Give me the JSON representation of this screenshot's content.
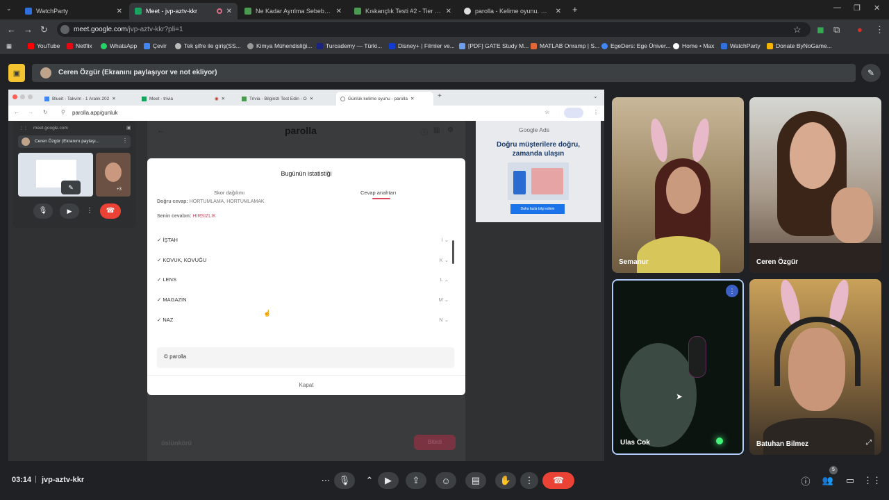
{
  "browser": {
    "tabs": [
      {
        "title": "WatchParty",
        "color": "#2f6fe0"
      },
      {
        "title": "Meet - jvp-aztv-kkr",
        "color": "#1ba261"
      },
      {
        "title": "Ne Kadar Ayrılma Sebebi?? #1",
        "color": "#4a9a52"
      },
      {
        "title": "Kıskançlık Testi #2 - Tier List, Kı",
        "color": "#4a9a52"
      },
      {
        "title": "parolla - Kelime oyunu. Günlük",
        "color": "#dddddd"
      }
    ],
    "url_host": "meet.google.com",
    "url_path": "/jvp-aztv-kkr?pli=1",
    "bookmarks": [
      "YouTube",
      "Netflix",
      "WhatsApp",
      "Çevir",
      "Tek şifre ile giriş(SS...",
      "Kimya Mühendisliği...",
      "Turcademy — Türki...",
      "Disney+ | Filmler ve...",
      "[PDF] GATE Study M...",
      "MATLAB Onramp | S...",
      "EgeDers: Ege Üniver...",
      "Home • Max",
      "WatchParty",
      "Donate ByNoGame..."
    ]
  },
  "meet": {
    "presenter_text": "Ceren Özgür (Ekranını paylaşıyor ve not ekliyor)",
    "time": "03:14",
    "meeting_code": "jvp-aztv-kkr",
    "people_count": "5",
    "participants": [
      {
        "name": "Semanur"
      },
      {
        "name": "Ceren Özgür"
      },
      {
        "name": "Ulas Cok"
      },
      {
        "name": "Batuhan Bilmez"
      }
    ]
  },
  "shared": {
    "tabs": [
      "Blueit - Takvim - 1 Aralık 202",
      "Meet - trivia",
      "Trivia - Bilginizi Test Edin - O",
      "Günlük kelime oyunu - parolla"
    ],
    "url": "parolla.app/gunluk",
    "site_title": "parolla",
    "ad_brand": "Google Ads",
    "ad_text": "Doğru müşterilere doğru, zamanda ulaşın",
    "ad_button": "Daha fazla bilgi edinin",
    "pip_host": "meet.google.com",
    "pip_title": "Ceren Özgür (Ekranını paylaşı...",
    "bottom_left": "üstünkörü",
    "bottom_right": "Bitirdi",
    "modal": {
      "title": "Bugünün istatistiği",
      "tab1": "Skor dağılımı",
      "tab2": "Cevap anahtarı",
      "correct_label": "Doğru cevap:",
      "correct_value": "HORTUMLAMA, HORTUMLAMAK",
      "yours_label": "Senin cevabın:",
      "yours_value": "HIRSIZLIK",
      "rows": [
        {
          "word": "✓ İŞTAH",
          "letter": "İ"
        },
        {
          "word": "✓ KOVUK, KOVUĞU",
          "letter": "K"
        },
        {
          "word": "✓ LENS",
          "letter": "L"
        },
        {
          "word": "✓ MAGAZİN",
          "letter": "M"
        },
        {
          "word": "✓ NAZ",
          "letter": "N"
        }
      ],
      "footer_brand": "© parolla",
      "close": "Kapat"
    }
  },
  "icons": [
    "present-icon",
    "tab-close-icon",
    "back-icon",
    "forward-icon",
    "reload-icon",
    "star-icon",
    "mic-icon",
    "camera-icon",
    "hangup-icon",
    "info-icon",
    "people-icon",
    "chat-icon",
    "activities-icon"
  ]
}
